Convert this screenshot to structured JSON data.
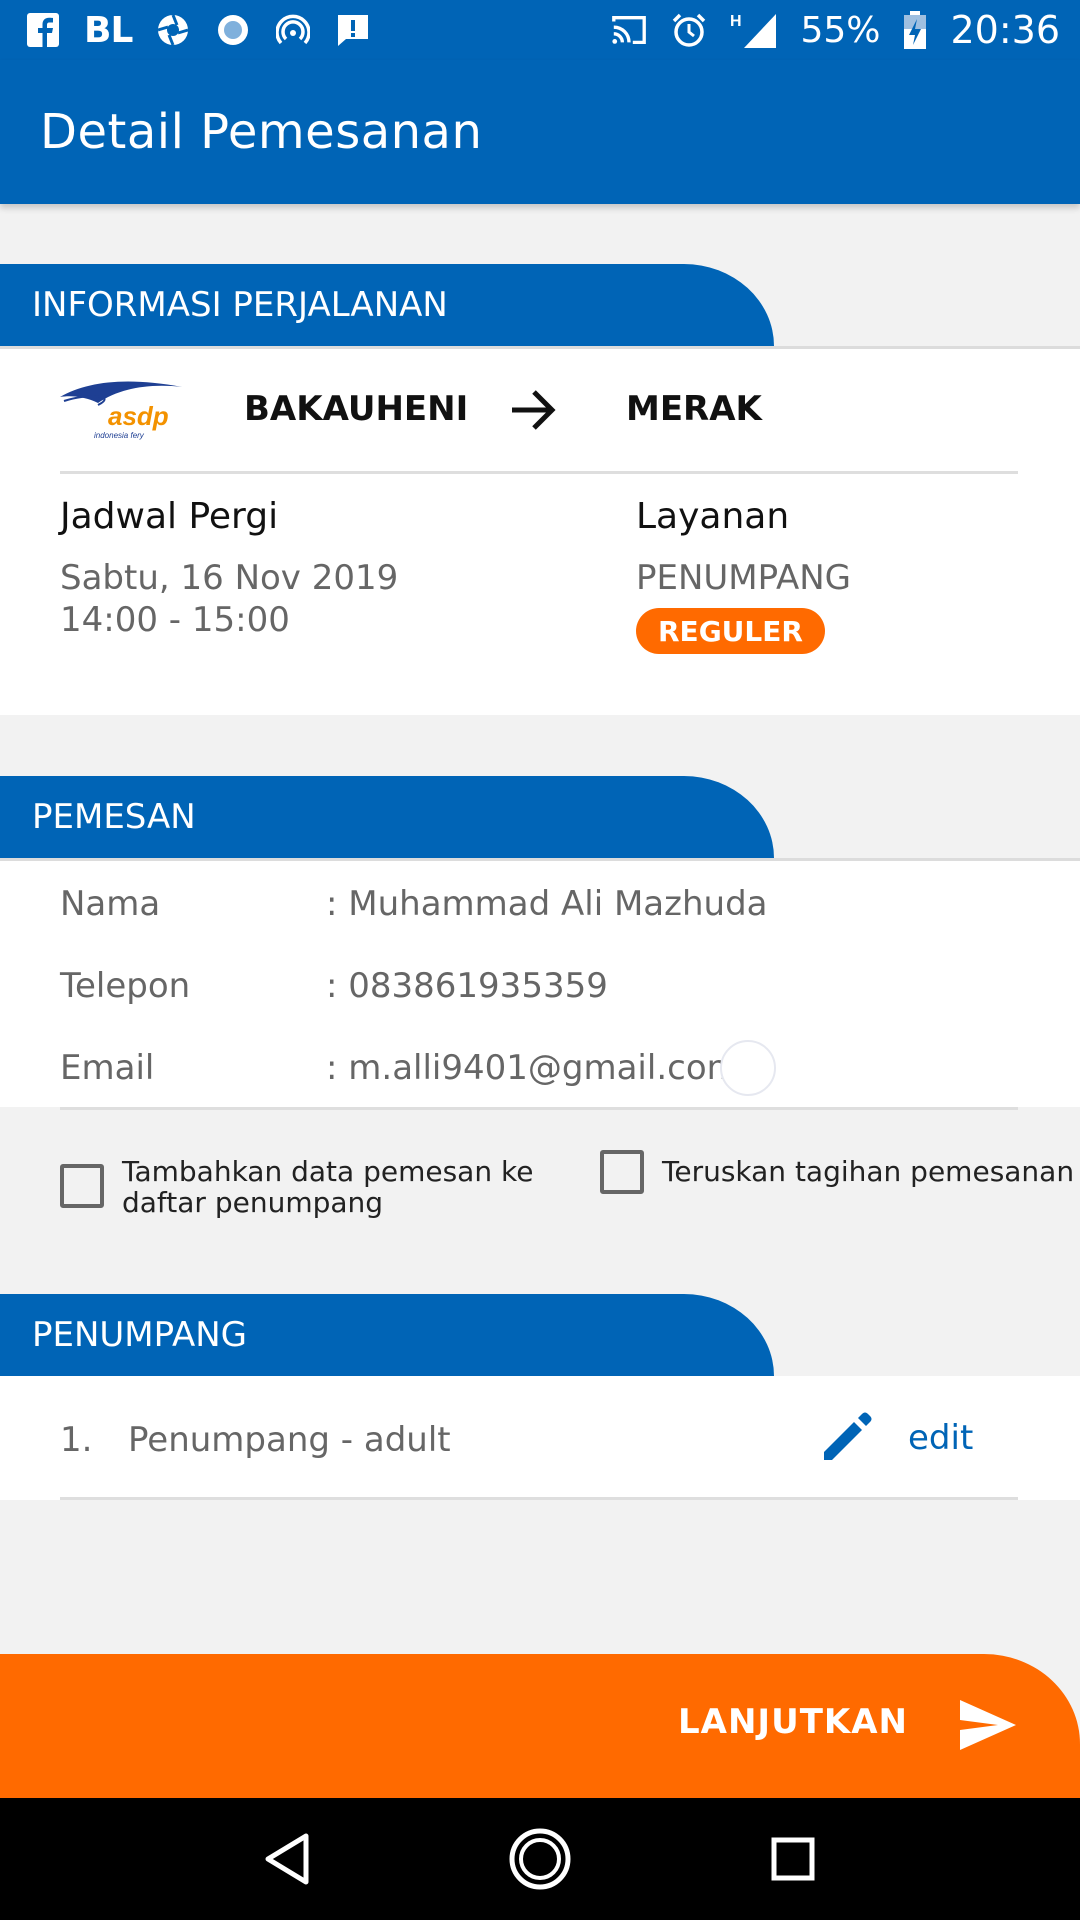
{
  "status_bar": {
    "carrier_tag": "BL",
    "network": "H",
    "battery": "55%",
    "time": "20:36",
    "icons": [
      "facebook-icon",
      "bl-icon",
      "aperture-icon",
      "record-icon",
      "hotspot-icon",
      "alert-message-icon",
      "cast-icon",
      "alarm-icon",
      "signal-icon",
      "battery-icon"
    ]
  },
  "app_bar": {
    "title": "Detail Pemesanan"
  },
  "trip": {
    "section_title": "INFORMASI PERJALANAN",
    "logo_text": "asdp",
    "logo_subtext": "indonesia fery",
    "origin": "BAKAUHENI",
    "destination": "MERAK",
    "schedule_label": "Jadwal Pergi",
    "schedule_date": "Sabtu, 16 Nov 2019",
    "schedule_time": "14:00 - 15:00",
    "service_label": "Layanan",
    "service_value": "PENUMPANG",
    "service_badge": "REGULER"
  },
  "booker": {
    "section_title": "PEMESAN",
    "rows": [
      {
        "label": "Nama",
        "value": ": Muhammad Ali Mazhuda"
      },
      {
        "label": "Telepon",
        "value": ": 083861935359"
      },
      {
        "label": "Email",
        "value": ": m.alli9401@gmail.com"
      }
    ],
    "checkbox_add_line1": "Tambahkan data pemesan ke",
    "checkbox_add_line2": "daftar penumpang",
    "checkbox_forward": "Teruskan tagihan pemesanan"
  },
  "passengers": {
    "section_title": "PENUMPANG",
    "items": [
      {
        "number": "1.",
        "name": "Penumpang - adult",
        "edit_label": "edit"
      }
    ]
  },
  "actions": {
    "continue_label": "LANJUTKAN"
  },
  "colors": {
    "primary": "#0064b6",
    "accent": "#ff6a00"
  }
}
